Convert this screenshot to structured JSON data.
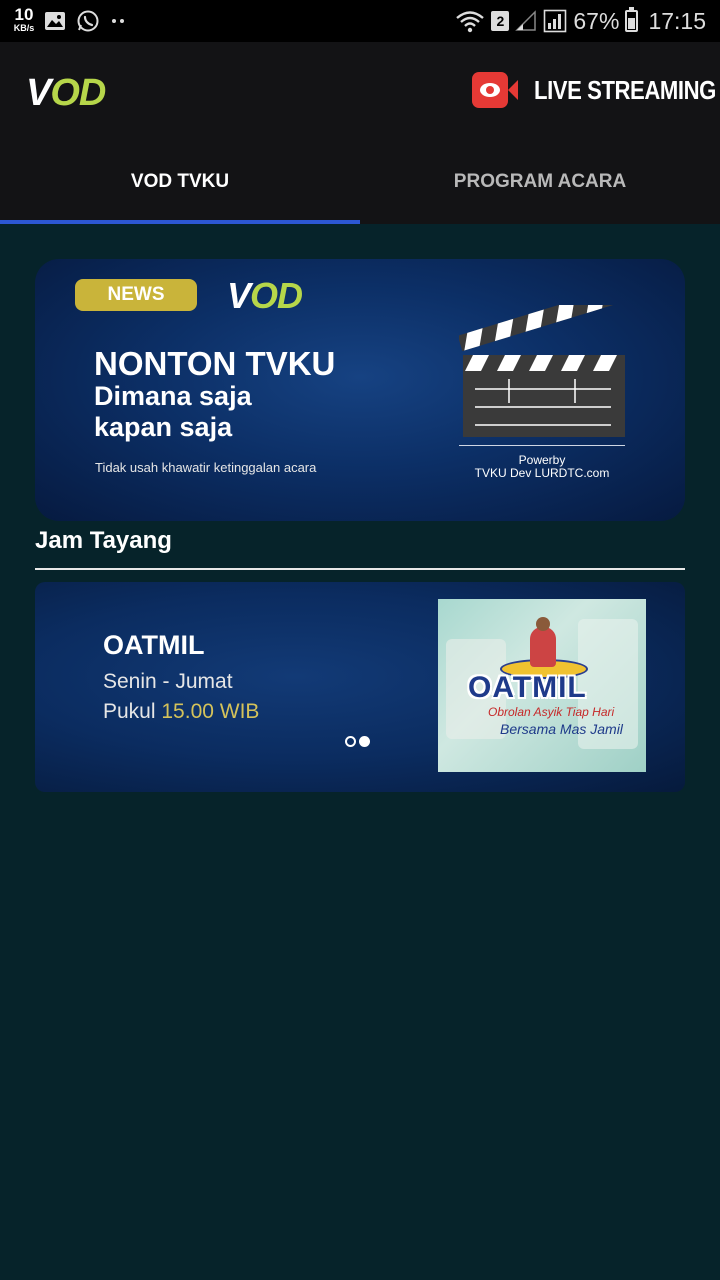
{
  "status_bar": {
    "speed_value": "10",
    "speed_unit": "KB/s",
    "sim_slot": "2",
    "battery": "67%",
    "time": "17:15"
  },
  "app_bar": {
    "logo_v": "V",
    "logo_od": "OD",
    "live_label": "LIVE STREAMING"
  },
  "tabs": [
    {
      "label": "VOD TVKU",
      "active": true
    },
    {
      "label": "PROGRAM ACARA",
      "active": false
    }
  ],
  "banner": {
    "badge": "NEWS",
    "logo_v": "V",
    "logo_od": "OD",
    "headline": "NONTON TVKU",
    "line1": "Dimana saja",
    "line2": "kapan saja",
    "tagline": "Tidak usah khawatir ketinggalan acara",
    "powered_line1": "Powerby",
    "powered_line2": "TVKU Dev LURDTC.com"
  },
  "section": {
    "title": "Jam Tayang"
  },
  "schedule": {
    "program": "OATMIL",
    "days": "Senin - Jumat",
    "time_prefix": "Pukul",
    "time_value": "15.00 WIB",
    "thumb_title": "OATMIL",
    "thumb_sub1": "Obrolan Asyik Tiap Hari",
    "thumb_sub2": "Bersama Mas Jamil",
    "pager_active_index": 1,
    "pager_count": 2
  },
  "colors": {
    "background": "#06232a",
    "app_bar": "#131315",
    "accent_tab": "#2c57d3",
    "logo_green": "#b6d64a",
    "badge_gold": "#c9b43a",
    "live_red": "#e53935",
    "time_highlight": "#d4c25a"
  }
}
